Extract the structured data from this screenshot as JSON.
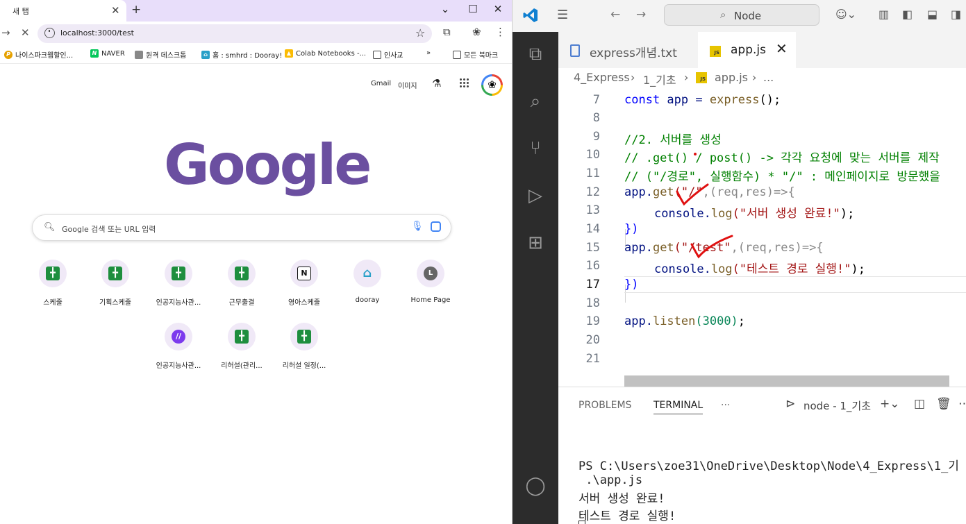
{
  "chrome": {
    "tab_title": "새 탭",
    "url": "localhost:3000/test",
    "bookmarks": [
      "나이스파크웹할인...",
      "NAVER",
      "원격 데스크톱",
      "홈 : smhrd : Dooray!",
      "Colab Notebooks -...",
      "인사교",
      "모든 북마크"
    ],
    "links": {
      "gmail": "Gmail",
      "images": "이미지"
    },
    "logo": "Google",
    "search_placeholder": "Google 검색 또는 URL 입력",
    "shortcuts_row1": [
      "스케줄",
      "기획스케줄",
      "인공지능사관...",
      "근무출결",
      "영아스케줄",
      "dooray",
      "Home Page"
    ],
    "shortcuts_row2": [
      "인공지능사관...",
      "리허설(관리...",
      "리허설 일정(..."
    ]
  },
  "vscode": {
    "command_center": "Node",
    "tabs": [
      {
        "label": "express개념.txt"
      },
      {
        "label": "app.js",
        "active": true
      }
    ],
    "breadcrumb": [
      "4_Express",
      "1_기초",
      "app.js",
      "..."
    ],
    "code_lines": [
      {
        "n": "7"
      },
      {
        "n": "8"
      },
      {
        "n": "9"
      },
      {
        "n": "10"
      },
      {
        "n": "11"
      },
      {
        "n": "12"
      },
      {
        "n": "13"
      },
      {
        "n": "14"
      },
      {
        "n": "15"
      },
      {
        "n": "16"
      },
      {
        "n": "17"
      },
      {
        "n": "18"
      },
      {
        "n": "19"
      },
      {
        "n": "20"
      },
      {
        "n": "21"
      }
    ],
    "code_text": {
      "l7_const": "const",
      "l7_rest": " app = ",
      "l7_fn": "express",
      "l7_end": "();",
      "l9": "//2. 서버를 생성",
      "l10": "// .get() / post() -> 각각 요청에 맞는 서버를 제작",
      "l11": "// (\"/경로\", 실행함수) * \"/\" : 메인페이지로 방문했을",
      "l12_a": "app.",
      "l12_fn": "get",
      "l12_str": "(\"/\"",
      "l12_args": ",(req,res)=>{",
      "l13_a": "console.",
      "l13_fn": "log",
      "l13_str": "(\"서버 생성 완료!\"",
      "l13_end": ");",
      "l14": "})",
      "l15_a": "app.",
      "l15_fn": "get",
      "l15_str": "(\"/test\"",
      "l15_args": ",(req,res)=>{",
      "l16_a": "console.",
      "l16_fn": "log",
      "l16_str": "(\"테스트 경로 실행!\"",
      "l16_end": ");",
      "l17": "})",
      "l19_a": "app.",
      "l19_fn": "listen",
      "l19_num": "(3000)",
      "l19_end": ";"
    },
    "panel": {
      "tabs": [
        "PROBLEMS",
        "TERMINAL",
        "···"
      ],
      "terminal_name": "node - 1_기초",
      "lines": [
        "PS C:\\Users\\zoe31\\OneDrive\\Desktop\\Node\\4_Express\\1_기",
        " .\\app.js",
        "서버 생성 완료!",
        "테스트 경로 실행!"
      ]
    }
  },
  "colors": {
    "chrome_tab_bg": "#e8defa",
    "google_logo": "#6b4fa0",
    "vscode_activity": "#2c2c2c",
    "annotation": "#e01010"
  }
}
